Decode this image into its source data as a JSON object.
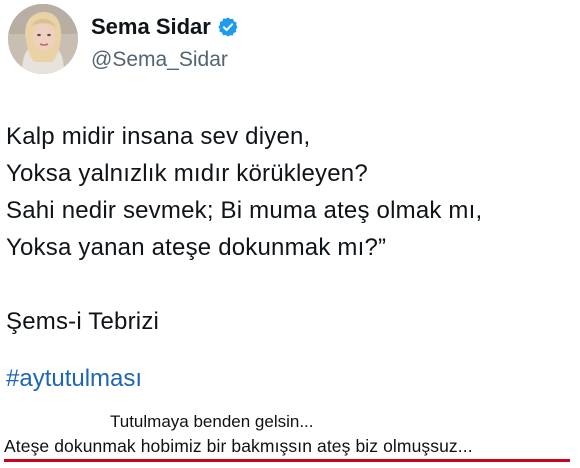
{
  "profile": {
    "display_name": "Sema Sidar",
    "handle": "@Sema_Sidar",
    "verified_icon": "verified-badge-icon"
  },
  "tweet": {
    "lines": [
      "Kalp midir insana sev diyen,",
      "Yoksa yalnızlık mıdır körükleyen?",
      "Sahi nedir sevmek; Bi muma ateş olmak mı,",
      "Yoksa yanan ateşe dokunmak mı?”"
    ],
    "attribution": "Şems-i Tebrizi",
    "hashtag": "#aytutulması"
  },
  "caption": {
    "line1": "Tutulmaya benden gelsin...",
    "line2": "Ateşe dokunmak hobimiz bir bakmışsın ateş biz olmuşsuz..."
  },
  "colors": {
    "hashtag": "#1d65b8",
    "verified": "#1d9bf0",
    "underline": "#d0021b",
    "handle": "#536471"
  }
}
